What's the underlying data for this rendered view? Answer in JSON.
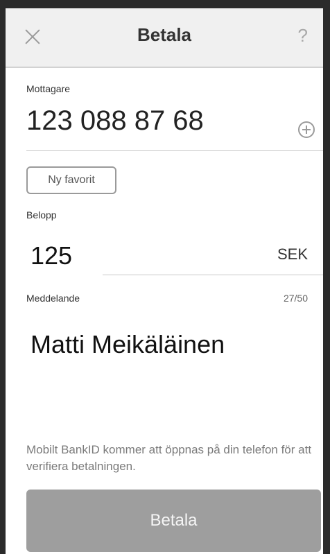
{
  "header": {
    "title": "Betala",
    "close_icon": "close-icon",
    "help_label": "?"
  },
  "recipient": {
    "label": "Mottagare",
    "value": "123 088 87 68",
    "add_icon": "plus-circle-icon"
  },
  "favorite": {
    "button_label": "Ny favorit"
  },
  "amount": {
    "label": "Belopp",
    "value": "125",
    "currency": "SEK"
  },
  "message": {
    "label": "Meddelande",
    "counter": "27/50",
    "value": "Matti Meikäläinen"
  },
  "footer": {
    "info_text": "Mobilt BankID kommer att öppnas på din telefon för att verifiera betalningen.",
    "pay_label": "Betala"
  },
  "colors": {
    "header_bg": "#f0f0f0",
    "pay_button_bg": "#9e9e9e",
    "frame": "#2b2b2b"
  }
}
